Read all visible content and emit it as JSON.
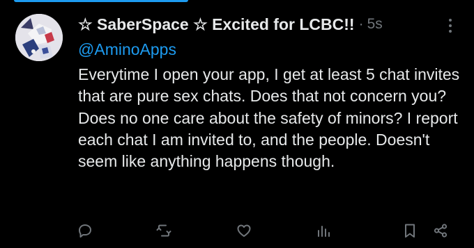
{
  "colors": {
    "background": "#000000",
    "text": "#e7e9ea",
    "muted": "#71767b",
    "link": "#1d9bf0"
  },
  "post": {
    "author": "☆ SaberSpace ☆ Excited for LCBC!!",
    "separator": "·",
    "time": "5s",
    "mention": "@AminoApps",
    "text": "Everytime I open your app, I get at least 5 chat invites that are pure sex chats. Does that not concern you? Does no one care about the safety of minors? I report each chat I am invited to, and the people. Doesn't seem like anything happens though."
  },
  "icons": {
    "more": "more-vertical-icon",
    "reply": "reply-icon",
    "repost": "repost-icon",
    "like": "heart-icon",
    "views": "views-bar-chart-icon",
    "bookmark": "bookmark-icon",
    "share": "share-icon"
  }
}
